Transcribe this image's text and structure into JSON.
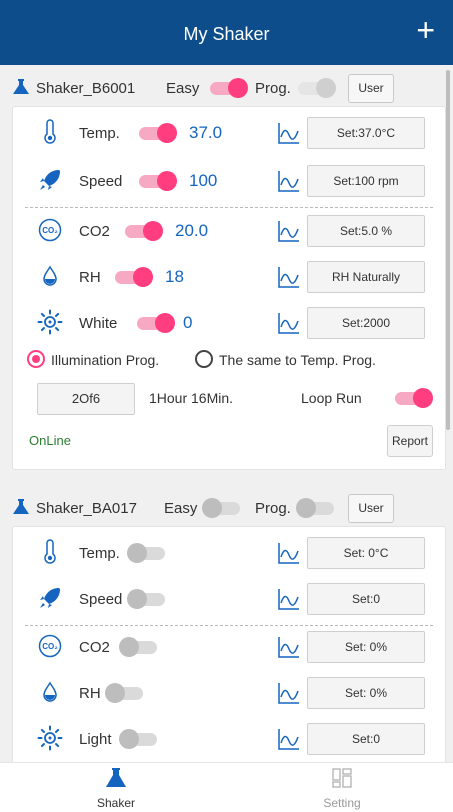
{
  "header": {
    "title": "My Shaker",
    "add_icon": "plus-icon"
  },
  "colors": {
    "header_bg": "#0d4d8c",
    "accent_pink": "#ff3d7f",
    "value_blue": "#1565c0",
    "online_green": "#2e7d32"
  },
  "devices": [
    {
      "name": "Shaker_B6001",
      "easy_label": "Easy",
      "easy_on": true,
      "prog_label": "Prog.",
      "prog_on": false,
      "user_label": "User",
      "rows": [
        {
          "label": "Temp.",
          "value": "37.0",
          "on": true,
          "set": "Set:37.0°C",
          "icon": "thermometer-icon"
        },
        {
          "label": "Speed",
          "value": "100",
          "on": true,
          "set": "Set:100 rpm",
          "icon": "rocket-icon"
        },
        {
          "label": "CO2",
          "value": "20.0",
          "on": true,
          "set": "Set:5.0 %",
          "icon": "co2-icon"
        },
        {
          "label": "RH",
          "value": "18",
          "on": true,
          "set": "RH Naturally",
          "icon": "droplet-icon"
        },
        {
          "label": "White",
          "value": "0",
          "on": true,
          "set": "Set:2000",
          "icon": "sun-icon"
        }
      ],
      "program": {
        "option_illumination": "Illumination Prog.",
        "option_same": "The same to Temp. Prog.",
        "selected": "illumination",
        "step": "2Of6",
        "duration": "1Hour 16Min.",
        "loop_label": "Loop Run",
        "loop_on": true
      },
      "status": "OnLine",
      "report_label": "Report"
    },
    {
      "name": "Shaker_BA017",
      "easy_label": "Easy",
      "easy_on": false,
      "prog_label": "Prog.",
      "prog_on": false,
      "user_label": "User",
      "rows": [
        {
          "label": "Temp.",
          "on": false,
          "set": "Set: 0°C",
          "icon": "thermometer-icon"
        },
        {
          "label": "Speed",
          "on": false,
          "set": "Set:0",
          "icon": "rocket-icon"
        },
        {
          "label": "CO2",
          "on": false,
          "set": "Set: 0%",
          "icon": "co2-icon"
        },
        {
          "label": "RH",
          "on": false,
          "set": "Set: 0%",
          "icon": "droplet-icon"
        },
        {
          "label": "Light",
          "on": false,
          "set": "Set:0",
          "icon": "sun-icon"
        }
      ]
    }
  ],
  "tabs": [
    {
      "label": "Shaker",
      "icon": "flask-icon",
      "active": true
    },
    {
      "label": "Setting",
      "icon": "grid-icon",
      "active": false
    }
  ]
}
